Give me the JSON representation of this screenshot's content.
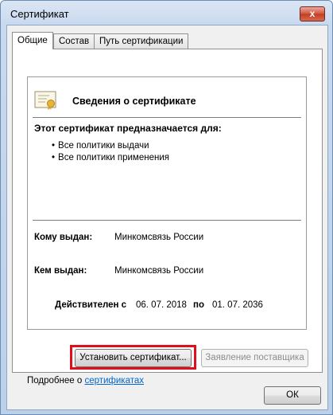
{
  "window": {
    "title": "Сертификат",
    "close_glyph": "x"
  },
  "tabs": [
    {
      "label": "Общие",
      "active": true
    },
    {
      "label": "Состав",
      "active": false
    },
    {
      "label": "Путь сертификации",
      "active": false
    }
  ],
  "info": {
    "title": "Сведения о сертификате",
    "purpose_title": "Этот сертификат предназначается для:",
    "purposes": [
      "Все политики выдачи",
      "Все политики применения"
    ],
    "issued_to_label": "Кому выдан:",
    "issued_to_value": "Минкомсвязь России",
    "issued_by_label": "Кем выдан:",
    "issued_by_value": "Минкомсвязь России",
    "valid_label": "Действителен с",
    "valid_from": "06. 07. 2018",
    "valid_to_label": "по",
    "valid_to": "01. 07. 2036"
  },
  "buttons": {
    "install": "Установить сертификат...",
    "issuer_statement": "Заявление поставщика",
    "ok": "ОК"
  },
  "more": {
    "prefix": "Подробнее о ",
    "link": "сертификатах"
  },
  "colors": {
    "highlight": "#e0101a",
    "link": "#0066cc"
  }
}
